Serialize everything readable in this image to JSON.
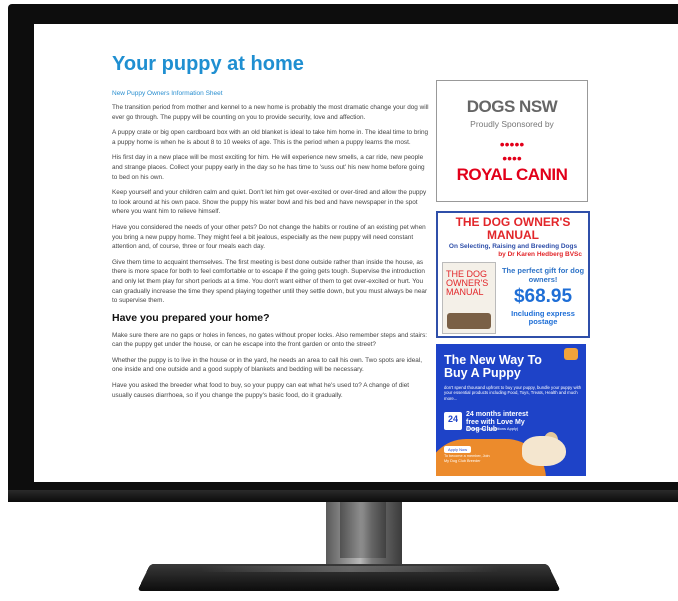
{
  "page": {
    "title": "Your puppy at home",
    "subtitle": "New Puppy Owners Information Sheet",
    "paragraphs_a": [
      "The transition period from mother and kennel to a new home is probably the most dramatic change your dog will ever go through. The puppy will be counting on you to provide security, love and affection.",
      "A puppy crate or big open cardboard box with an old blanket is ideal to take him home in. The ideal time to bring a puppy home is when he is about 8 to 10 weeks of age. This is the period when a puppy learns the most.",
      "His first day in a new place will be most exciting for him. He will experience new smells, a car ride, new people and strange places. Collect your puppy early in the day so he has time to 'suss out' his new home before going to bed on his own.",
      "Keep yourself and your children calm and quiet. Don't let him get over-excited or over-tired and allow the puppy to look around at his own pace. Show the puppy his water bowl and his bed and have newspaper in the spot where you want him to relieve himself.",
      "Have you considered the needs of your other pets? Do not change the habits or routine of an existing pet when you bring a new puppy home. They might feel a bit jealous, especially as the new puppy will need constant attention and, of course, three or four meals each day.",
      "Give them time to acquaint themselves. The first meeting is best done outside rather than inside the house, as there is more space for both to feel comfortable or to escape if the going gets tough. Supervise the introduction and only let them play for short periods at a time. You don't want either of them to get over-excited or hurt. You can gradually increase the time they spend playing together until they settle down, but you must always be near to supervise them."
    ],
    "heading2": "Have you prepared your home?",
    "paragraphs_b": [
      "Make sure there are no gaps or holes in fences, no gates without proper locks. Also remember steps and stairs: can the puppy get under the house, or can he escape into the front garden or onto the street?",
      "Whether the puppy is to live in the house or in the yard, he needs an area to call his own. Two spots are ideal, one inside and one outside and a good supply of blankets and bedding will be necessary.",
      "Have you asked the breeder what food to buy, so your puppy can eat what he's used to? A change of diet usually causes diarrhoea, so if you change the puppy's basic food, do it gradually."
    ]
  },
  "ads": {
    "dogsnsw": {
      "title": "DOGS NSW",
      "sponsor": "Proudly Sponsored by",
      "brand": "ROYAL CANIN"
    },
    "book": {
      "headline1": "THE DOG OWNER'S",
      "headline2": "MANUAL",
      "subline": "On Selecting, Raising and Breeding Dogs",
      "author": "by Dr Karen Hedberg BVSc",
      "cover_title": "THE DOG OWNER'S MANUAL",
      "gift": "The perfect gift for dog owners!",
      "price": "$68.95",
      "shipping": "Including express postage"
    },
    "newway": {
      "headline": "The New Way To Buy A Puppy",
      "body": "don't spend thousand upfront to buy your puppy, bundle your puppy with your essential products including Food, Toys, Treats, Health and much more...",
      "months": "24",
      "interest": "24 months interest free with Love My Dog Club",
      "interest_note": "(Terms and Conditions Apply)",
      "cta": "Apply Now",
      "footer": "To become a member, Join My Dog Club Breeder"
    }
  },
  "colors": {
    "heading_blue": "#1f8fd1",
    "royal_canin_red": "#e2001a",
    "ad_blue": "#1e43c8"
  }
}
